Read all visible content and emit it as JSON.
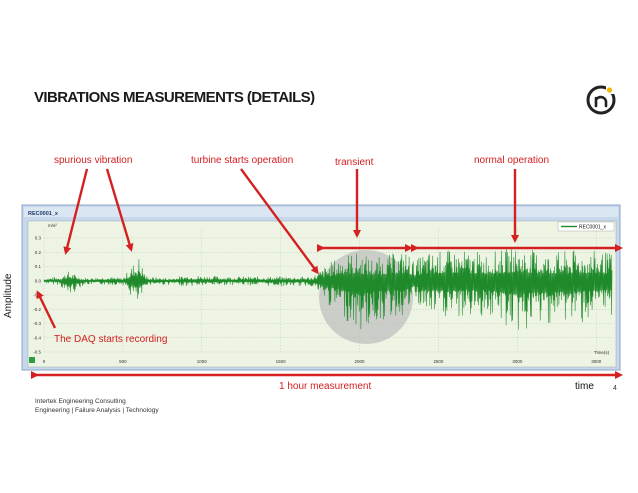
{
  "slide": {
    "title": "VIBRATIONS MEASUREMENTS (DETAILS)",
    "page_number": "4",
    "footer_line1": "Intertek Engineering Consulting",
    "footer_line2": "Engineering | Failure Analysis | Technology",
    "y_axis_title": "Amplitude",
    "x_axis_title": "time",
    "duration_label": "1 hour measurement",
    "logo_icon": "intertek-logo-icon"
  },
  "annotations": {
    "spurious": "spurious vibration",
    "turbine": "turbine starts operation",
    "transient": "transient",
    "normal": "normal operation",
    "daq": "The DAQ starts recording"
  },
  "colors": {
    "accent": "#d42020",
    "signal": "#1e8a2a",
    "panel": "#c8d8ec",
    "plot_bg": "#eef4e4"
  },
  "chart_data": {
    "type": "line",
    "window_title": "REC0001_x",
    "unit_label": "m/s²",
    "legend": "REC0001_x",
    "legend_position": "top-right",
    "x_axis_label": "Time(s)",
    "xlim": [
      0,
      3600
    ],
    "ylim": [
      -0.5,
      0.3
    ],
    "x_ticks": [
      0,
      500,
      1000,
      1500,
      2000,
      2500,
      3000,
      3500
    ],
    "y_ticks": [
      0.3,
      0.2,
      0.1,
      0.0,
      -0.1,
      -0.2,
      -0.3,
      -0.4,
      -0.5
    ],
    "grid": true,
    "series": [
      {
        "name": "REC0001_x",
        "envelope": [
          [
            0,
            0.02,
            -0.02
          ],
          [
            100,
            0.03,
            -0.03
          ],
          [
            150,
            0.07,
            -0.12
          ],
          [
            250,
            0.02,
            -0.03
          ],
          [
            400,
            0.03,
            -0.03
          ],
          [
            500,
            0.02,
            -0.03
          ],
          [
            600,
            0.18,
            -0.2
          ],
          [
            650,
            0.03,
            -0.03
          ],
          [
            800,
            0.02,
            -0.03
          ],
          [
            900,
            0.04,
            -0.04
          ],
          [
            1200,
            0.03,
            -0.03
          ],
          [
            1500,
            0.03,
            -0.04
          ],
          [
            1700,
            0.03,
            -0.04
          ],
          [
            1800,
            0.12,
            -0.18
          ],
          [
            1900,
            0.2,
            -0.26
          ],
          [
            2000,
            0.2,
            -0.38
          ],
          [
            2100,
            0.16,
            -0.3
          ],
          [
            2300,
            0.22,
            -0.25
          ],
          [
            2350,
            0.13,
            -0.13
          ],
          [
            2400,
            0.2,
            -0.25
          ],
          [
            2600,
            0.22,
            -0.28
          ],
          [
            2800,
            0.2,
            -0.25
          ],
          [
            3000,
            0.24,
            -0.38
          ],
          [
            3200,
            0.2,
            -0.3
          ],
          [
            3400,
            0.22,
            -0.3
          ],
          [
            3600,
            0.2,
            -0.25
          ]
        ]
      }
    ]
  }
}
